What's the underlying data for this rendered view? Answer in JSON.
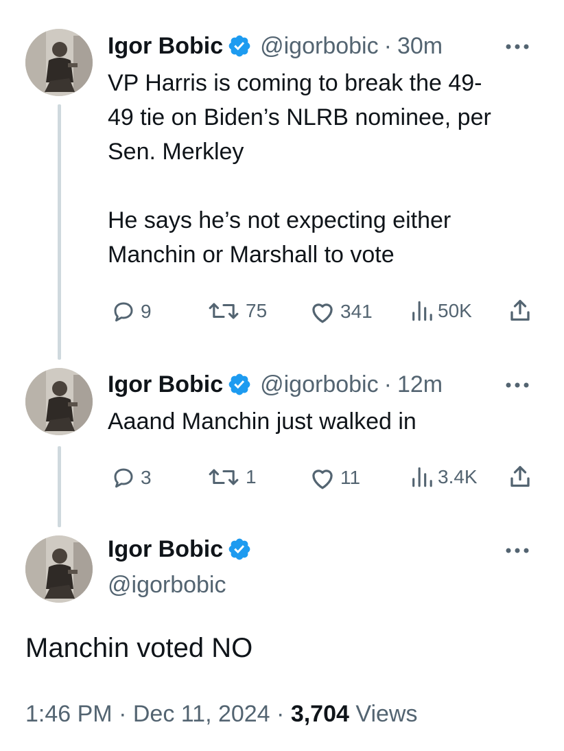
{
  "thread": [
    {
      "author": {
        "name": "Igor Bobic",
        "handle": "@igorbobic",
        "verified": true,
        "avatar": "avatar-photo"
      },
      "separator": "·",
      "time": "30m",
      "text": "VP Harris is coming to break the 49-\n49 tie on Biden’s NLRB nominee, per\nSen. Merkley\n\nHe says he’s not expecting either\nManchin or Marshall to vote",
      "actions": {
        "replies": "9",
        "reposts": "75",
        "likes": "341",
        "views": "50K"
      },
      "icons": {
        "reply": "reply-icon",
        "repost": "repost-icon",
        "like": "heart-icon",
        "views": "views-icon",
        "share": "share-icon",
        "more": "more-icon"
      }
    },
    {
      "author": {
        "name": "Igor Bobic",
        "handle": "@igorbobic",
        "verified": true,
        "avatar": "avatar-photo"
      },
      "separator": "·",
      "time": "12m",
      "text": "Aaand Manchin just walked in",
      "actions": {
        "replies": "3",
        "reposts": "1",
        "likes": "11",
        "views": "3.4K"
      }
    }
  ],
  "main_tweet": {
    "author": {
      "name": "Igor Bobic",
      "handle": "@igorbobic",
      "verified": true
    },
    "text": "Manchin voted NO",
    "time": "1:46 PM",
    "separator": "·",
    "date": "Dec 11, 2024",
    "views_count": "3,704",
    "views_label": "Views"
  },
  "colors": {
    "text": "#0f1419",
    "secondary": "#536471",
    "verified": "#1d9bf0",
    "thread_line": "#cfd9de"
  }
}
